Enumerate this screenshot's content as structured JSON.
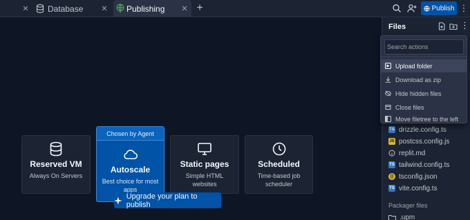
{
  "tabs": [
    {
      "label": "Database",
      "icon": "database-icon"
    },
    {
      "label": "Publishing",
      "icon": "globe-icon",
      "active": true
    }
  ],
  "toolbar": {
    "publish_label": "Publish",
    "more_icon": "⋮"
  },
  "cards": {
    "vm": {
      "title": "Reserved VM",
      "subtitle": "Always On Servers",
      "icon": "database-icon"
    },
    "autoscale": {
      "badge": "Chosen by Agent",
      "title": "Autoscale",
      "subtitle": "Best choice for most apps",
      "icon": "cloud-icon"
    },
    "static": {
      "title": "Static pages",
      "subtitle": "Simple HTML websites",
      "icon": "monitor-icon"
    },
    "scheduled": {
      "title": "Scheduled",
      "subtitle": "Time-based job scheduler",
      "icon": "clock-icon"
    }
  },
  "upgrade": {
    "label": "Upgrade your plan to publish",
    "icon": "sparkle-icon"
  },
  "files": {
    "title": "Files",
    "items": [
      {
        "name": "drizzle.config.ts",
        "badge": "TS",
        "color": "#3178c6"
      },
      {
        "name": "postcss.config.js",
        "badge": "JS",
        "color": "#d4b830"
      },
      {
        "name": "replit.md",
        "badge": "",
        "color": ""
      },
      {
        "name": "tailwind.config.ts",
        "badge": "TS",
        "color": "#3178c6"
      },
      {
        "name": "tsconfig.json",
        "badge": "{}",
        "color": "#d4b830"
      },
      {
        "name": "vite.config.ts",
        "badge": "TS",
        "color": "#3178c6"
      }
    ],
    "packager_title": "Packager files",
    "packager_item": ".upm"
  },
  "menu": {
    "search_placeholder": "Search actions",
    "items": [
      {
        "label": "Upload folder",
        "icon": "upload-folder-icon",
        "active": true
      },
      {
        "label": "Download as zip",
        "icon": "download-icon"
      },
      {
        "label": "Hide hidden files",
        "icon": "eye-off-icon"
      },
      {
        "label": "Close files",
        "icon": "close-files-icon"
      },
      {
        "label": "Move filetree to the left",
        "icon": "sidebar-left-icon"
      }
    ]
  },
  "colors": {
    "background": "#0e1525",
    "panel": "#1c2333",
    "accent": "#0053a6"
  }
}
